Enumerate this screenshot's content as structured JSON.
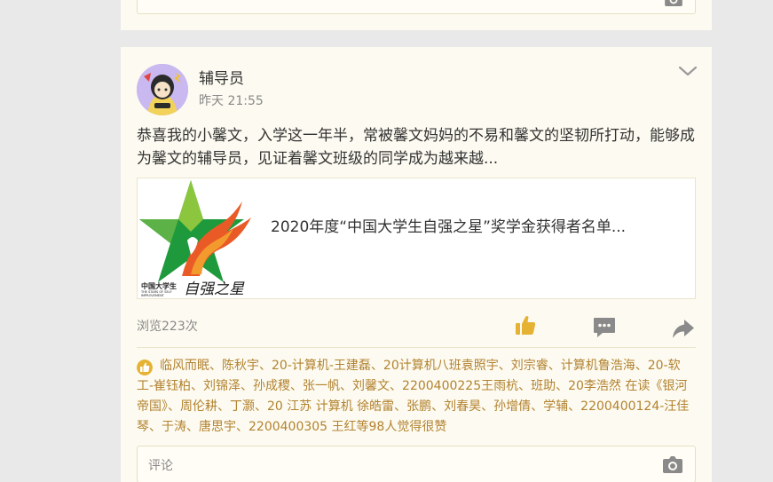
{
  "post": {
    "author": "辅导员",
    "time": "昨天 21:55",
    "text": "恭喜我的小馨文，入学这一年半，常被馨文妈妈的不易和馨文的坚韧所打动，能够成为馨文的辅导员，见证着馨文班级的同学成为越来越...",
    "share": {
      "title": "2020年度“中国大学生自强之星”奖学金获得者名单...",
      "logo_text_cn": "中国大学生",
      "logo_text_en1": "THE STARS OF SELF",
      "logo_text_en2": "IMPROVEMENT",
      "logo_script": "自强之星"
    },
    "views": "浏览223次",
    "likes": "临风而眠、陈秋宇、20-计算机-王建磊、20计算机八班袁照宇、刘宗睿、计算机鲁浩海、20-软工-崔钰柏、刘锦泽、孙成稷、张一帆、刘馨文、2200400225王雨杭、班助、20李浩然 在读《银河帝国》、周伦耕、丁灏、20 江苏 计算机 徐皓雷、张鹏、刘春昊、孙增倩、学辅、2200400124-汪佳琴、于涛、唐思宇、2200400305 王红等98人觉得很赞",
    "comment_placeholder": "评论"
  },
  "icons": {
    "chevron": "chevron-down-icon",
    "like": "thumbs-up-icon",
    "comment": "comment-icon",
    "share": "share-arrow-icon",
    "camera": "camera-icon"
  },
  "colors": {
    "card_bg": "#fdfbf1",
    "accent": "#e5b233",
    "likes_text": "#b2822f",
    "icon_gray": "#8a8a8a"
  }
}
